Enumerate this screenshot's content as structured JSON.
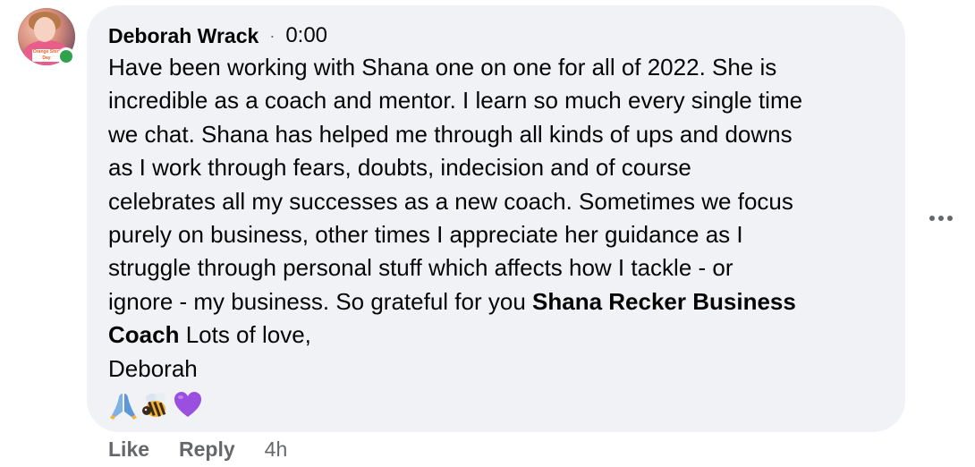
{
  "comment": {
    "author": "Deborah Wrack",
    "separator": "·",
    "time": "0:00",
    "lines": [
      "Have been working with Shana one on one for all of 2022. She is",
      "incredible as a coach and mentor. I learn so much every single time",
      "we chat. Shana has helped me through all kinds of ups and downs",
      "as I work through fears, doubts, indecision and of course",
      "celebrates all my successes as a new coach. Sometimes we focus",
      "purely on business, other times I appreciate her guidance as I",
      "struggle through personal stuff which affects how I tackle - or"
    ],
    "line8_prefix": "ignore - my business. So grateful for you ",
    "mention_part1": "Shana Recker Business",
    "mention_part2": "Coach",
    "line9_suffix": " Lots of love,",
    "signoff": "Deborah",
    "emojis": [
      "praying-hands-emoji",
      "bee-emoji",
      "purple-heart-emoji"
    ],
    "avatar_badge_text": "Orange Shirt Day"
  },
  "actions": {
    "like": "Like",
    "reply": "Reply",
    "ago": "4h"
  },
  "icons": {
    "more": "more-options-icon"
  },
  "colors": {
    "bubble": "#f0f2f5",
    "secondary_text": "#65676b",
    "online": "#31a24c"
  }
}
